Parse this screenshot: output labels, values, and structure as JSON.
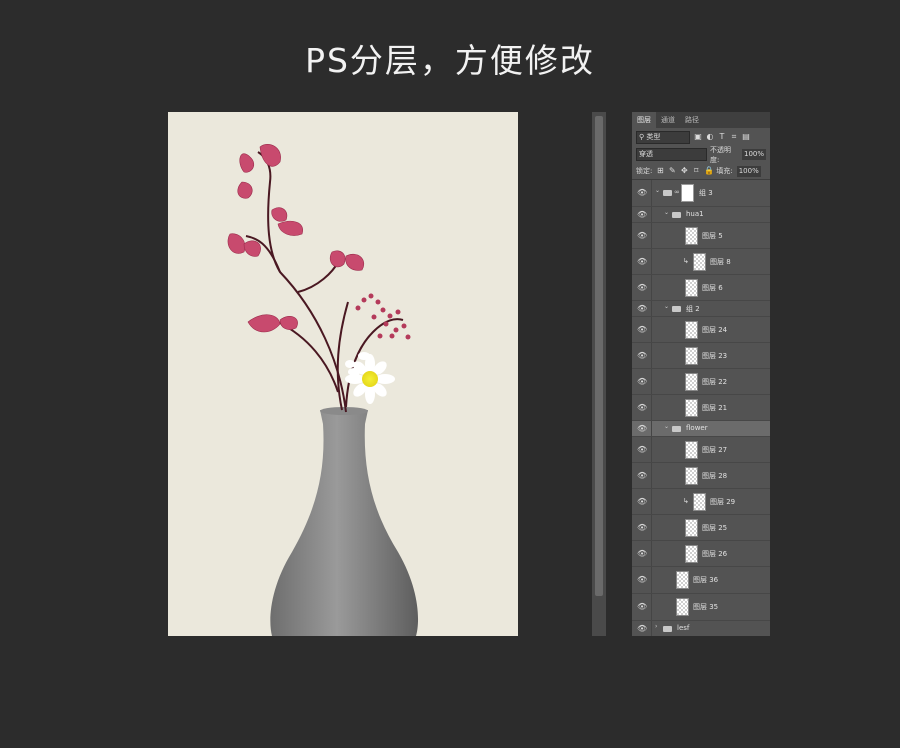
{
  "page": {
    "title": "PS分层，方便修改"
  },
  "layers_panel": {
    "tabs": [
      "图层",
      "通道",
      "路径"
    ],
    "filter_kind": "类型",
    "blend_mode": "穿透",
    "opacity_label": "不透明度:",
    "opacity_value": "100%",
    "lock_label": "锁定:",
    "fill_label": "填充:",
    "fill_value": "100%",
    "layers": [
      {
        "name": "组 3",
        "kind": "group-mask",
        "indent": 0,
        "expanded": true
      },
      {
        "name": "hua1",
        "kind": "folder",
        "indent": 1,
        "expanded": true
      },
      {
        "name": "图层 5",
        "kind": "layer",
        "indent": 2
      },
      {
        "name": "图层 8",
        "kind": "layer",
        "indent": 2,
        "clipped": true
      },
      {
        "name": "图层 6",
        "kind": "layer",
        "indent": 2
      },
      {
        "name": "组 2",
        "kind": "folder",
        "indent": 1,
        "expanded": true
      },
      {
        "name": "图层 24",
        "kind": "layer",
        "indent": 2
      },
      {
        "name": "图层 23",
        "kind": "layer",
        "indent": 2
      },
      {
        "name": "图层 22",
        "kind": "layer",
        "indent": 2
      },
      {
        "name": "图层 21",
        "kind": "layer",
        "indent": 2
      },
      {
        "name": "flower",
        "kind": "folder",
        "indent": 1,
        "expanded": true,
        "selected": true
      },
      {
        "name": "图层 27",
        "kind": "layer",
        "indent": 2
      },
      {
        "name": "图层 28",
        "kind": "layer",
        "indent": 2
      },
      {
        "name": "图层 29",
        "kind": "layer",
        "indent": 2,
        "clipped": true
      },
      {
        "name": "图层 25",
        "kind": "layer",
        "indent": 2
      },
      {
        "name": "图层 26",
        "kind": "layer",
        "indent": 2
      },
      {
        "name": "图层 36",
        "kind": "layer",
        "indent": 1
      },
      {
        "name": "图层 35",
        "kind": "layer",
        "indent": 1
      },
      {
        "name": "lesf",
        "kind": "folder",
        "indent": 0,
        "expanded": false
      }
    ]
  },
  "colors": {
    "background": "#2c2c2c",
    "canvas": "#ebe8dc",
    "leaf": "#c84a6e",
    "vase": "#7c7c7c"
  }
}
